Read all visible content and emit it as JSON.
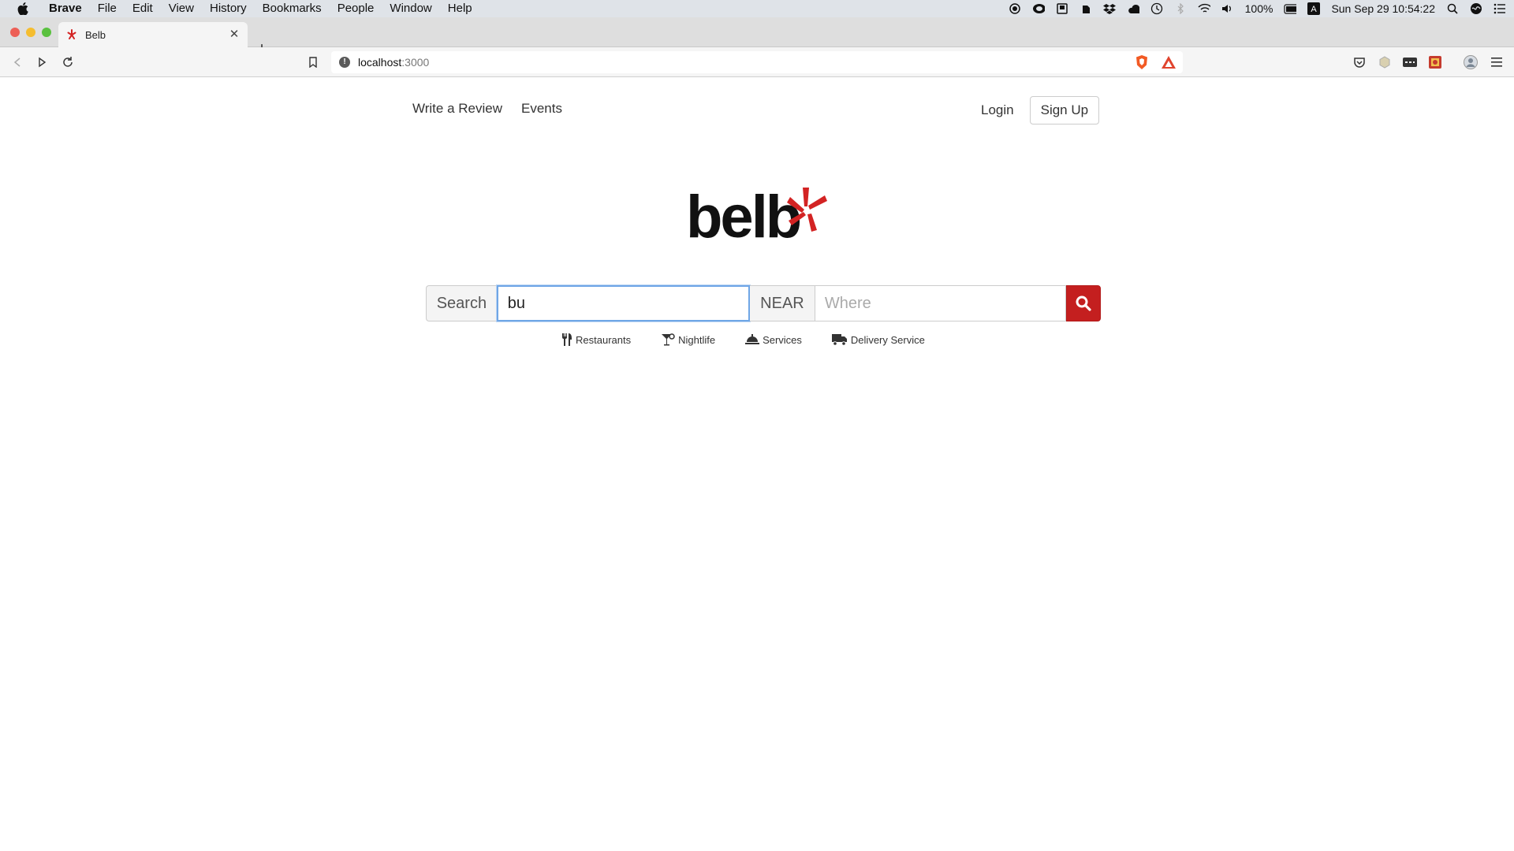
{
  "menubar": {
    "app": "Brave",
    "items": [
      "File",
      "Edit",
      "View",
      "History",
      "Bookmarks",
      "People",
      "Window",
      "Help"
    ],
    "battery": "100%",
    "datetime": "Sun Sep 29  10:54:22"
  },
  "browser": {
    "tab_title": "Belb",
    "url_host": "localhost",
    "url_port": ":3000"
  },
  "nav": {
    "write_review": "Write a Review",
    "events": "Events",
    "login": "Login",
    "signup": "Sign Up"
  },
  "logo": {
    "text": "belb",
    "accent_color": "#d32323"
  },
  "search": {
    "search_label": "Search",
    "query_value": "bu",
    "near_label": "NEAR",
    "where_placeholder": "Where",
    "button_color": "#c41f1f"
  },
  "categories": [
    {
      "label": "Restaurants",
      "icon": "utensils-icon"
    },
    {
      "label": "Nightlife",
      "icon": "cocktail-icon"
    },
    {
      "label": "Services",
      "icon": "service-bell-icon"
    },
    {
      "label": "Delivery Service",
      "icon": "truck-icon"
    }
  ]
}
